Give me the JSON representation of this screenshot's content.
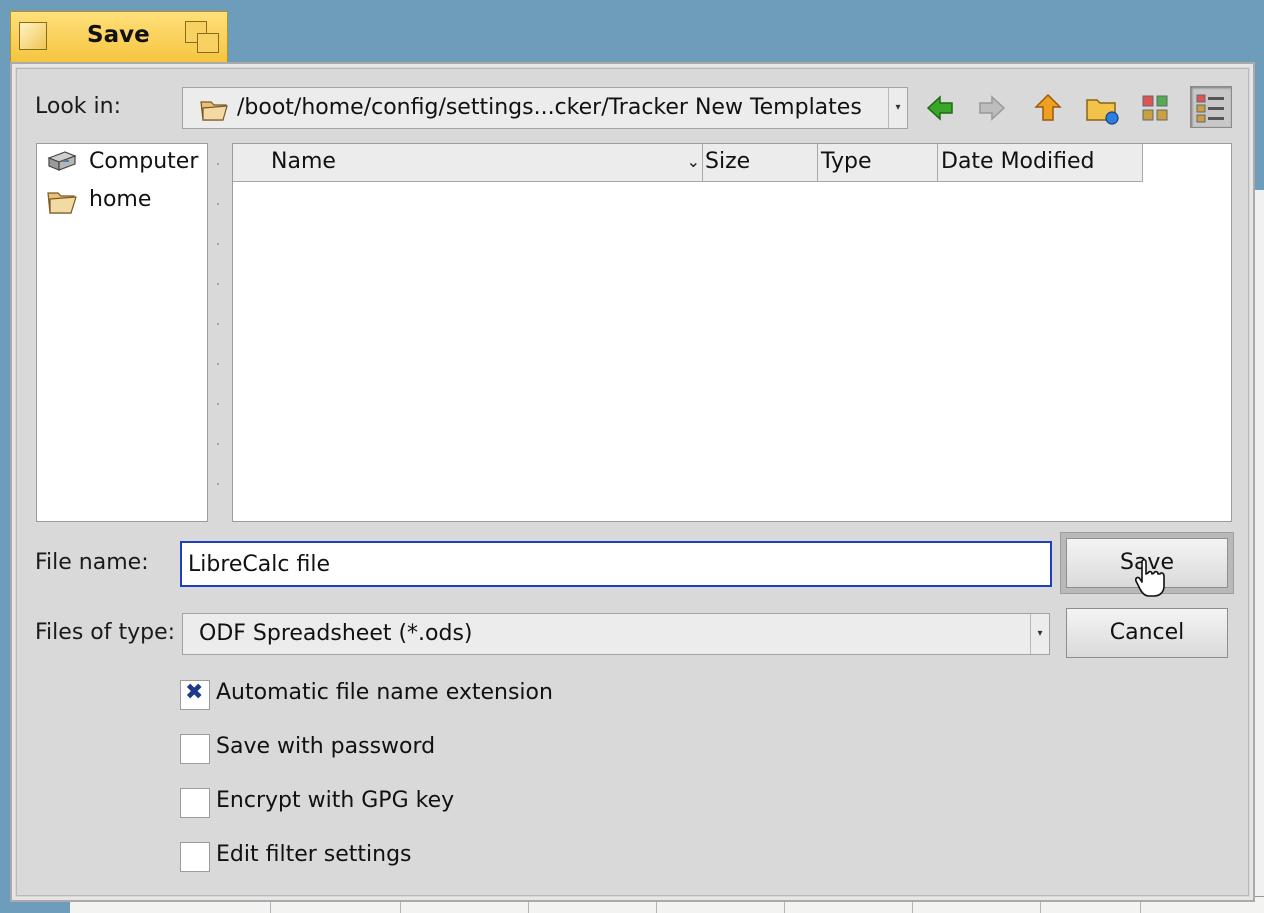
{
  "window": {
    "title": "Save"
  },
  "look_in": {
    "label": "Look in:",
    "path": "/boot/home/config/settings...cker/Tracker New Templates"
  },
  "toolbar": {
    "back": "back-arrow-icon",
    "forward": "forward-arrow-icon",
    "up": "up-arrow-icon",
    "new_folder": "new-folder-icon",
    "list_view": "list-view-icon",
    "detail_view": "detail-view-icon"
  },
  "places": [
    {
      "label": "Computer",
      "icon": "computer-icon"
    },
    {
      "label": "home",
      "icon": "folder-icon"
    }
  ],
  "file_list": {
    "columns": [
      "Name",
      "Size",
      "Type",
      "Date Modified"
    ],
    "sort_column": "Name",
    "rows": []
  },
  "file_name": {
    "label": "File name:",
    "value": "LibreCalc file"
  },
  "file_type": {
    "label": "Files of type:",
    "value": "ODF Spreadsheet (*.ods)"
  },
  "buttons": {
    "save": "Save",
    "cancel": "Cancel"
  },
  "options": [
    {
      "label": "Automatic file name extension",
      "checked": true
    },
    {
      "label": "Save with password",
      "checked": false
    },
    {
      "label": "Encrypt with GPG key",
      "checked": false
    },
    {
      "label": "Edit filter settings",
      "checked": false
    }
  ],
  "colors": {
    "title_tab": "#f5c540",
    "desktop": "#6d9dba",
    "focus_border": "#1f3fbf",
    "back_arrow": "#3aa52a",
    "up_arrow": "#f0a020"
  }
}
